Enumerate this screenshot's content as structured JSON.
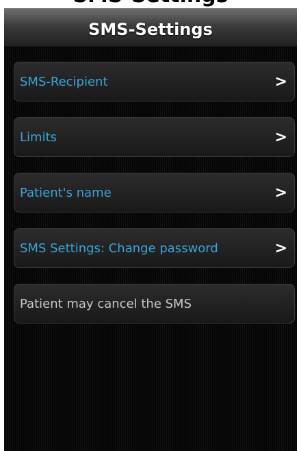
{
  "header": {
    "title": "SMS-Settings"
  },
  "items": [
    {
      "label": "SMS-Recipient",
      "icon": "chevron-right-icon",
      "glyph": ">"
    },
    {
      "label": "Limits",
      "icon": "chevron-right-icon",
      "glyph": ">"
    },
    {
      "label": "Patient's name",
      "icon": "chevron-right-icon",
      "glyph": ">"
    },
    {
      "label": "SMS Settings: Change password",
      "icon": "chevron-right-icon",
      "glyph": ">"
    },
    {
      "label": "Patient may cancel the SMS"
    }
  ],
  "colors": {
    "link_text": "#3aa4d8",
    "static_text": "#c8c8c8",
    "background": "#0a0a0a",
    "title_text": "#ffffff"
  }
}
